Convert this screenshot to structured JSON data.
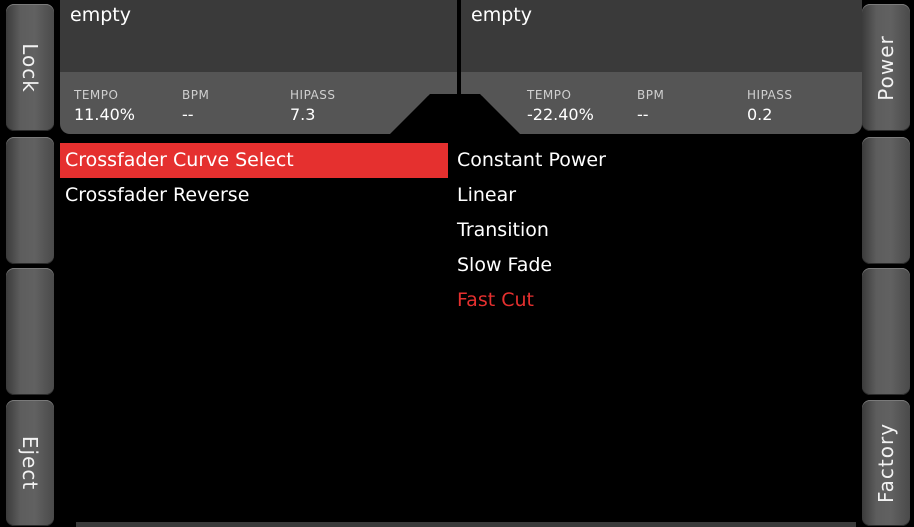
{
  "side_buttons": {
    "left": [
      "Lock",
      "",
      "",
      "Eject"
    ],
    "right": [
      "Power",
      "",
      "",
      "Factory"
    ]
  },
  "deck_a": {
    "title": "empty",
    "params": [
      {
        "label": "TEMPO",
        "value": "11.40%"
      },
      {
        "label": "BPM",
        "value": "--"
      },
      {
        "label": "HIPASS",
        "value": "7.3"
      }
    ]
  },
  "deck_b": {
    "title": "empty",
    "params": [
      {
        "label": "TEMPO",
        "value": "-22.40%"
      },
      {
        "label": "BPM",
        "value": "--"
      },
      {
        "label": "HIPASS",
        "value": "0.2"
      }
    ]
  },
  "menu": {
    "items": [
      "Crossfader Curve Select",
      "Crossfader Reverse"
    ],
    "selected_index": 0
  },
  "options": {
    "items": [
      "Constant Power",
      "Linear",
      "Transition",
      "Slow Fade",
      "Fast Cut"
    ],
    "active_index": 4
  },
  "colors": {
    "accent": "#e5302f",
    "panel_dark": "#3a3a3a",
    "panel_light": "#555555"
  }
}
